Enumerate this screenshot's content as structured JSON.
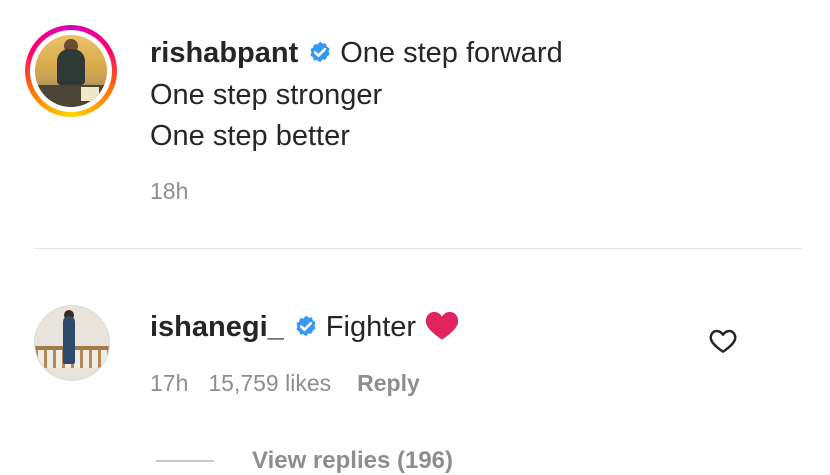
{
  "post": {
    "username": "rishabpant",
    "caption_line1": "One step forward",
    "caption_line2": "One step stronger",
    "caption_line3": "One step better",
    "time": "18h"
  },
  "comment": {
    "username": "ishanegi_",
    "text": "Fighter",
    "time": "17h",
    "likes": "15,759 likes",
    "reply_label": "Reply",
    "view_replies": "View replies (196)"
  },
  "icons": {
    "verified": "verified-badge-icon",
    "emoji": "red-heart-emoji",
    "like": "heart-outline-icon"
  },
  "colors": {
    "verified": "#3897f0",
    "heart": "#e0245e",
    "meta": "#8e8e8e"
  }
}
